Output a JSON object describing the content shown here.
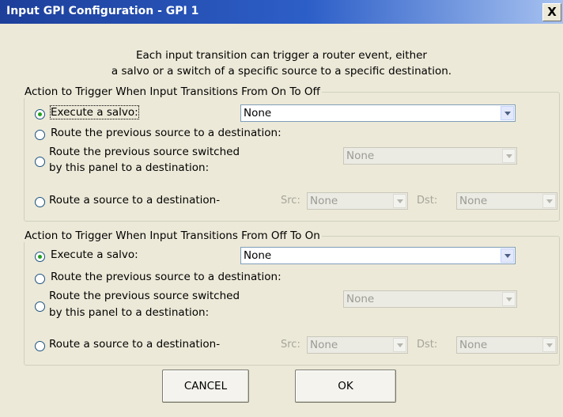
{
  "window": {
    "title": "Input GPI Configuration - GPI 1",
    "close_glyph": "X"
  },
  "description": {
    "line1": "Each input transition can trigger a router event, either",
    "line2": "a salvo or a switch of a specific source to a specific destination."
  },
  "groups": [
    {
      "legend": "Action to Trigger When Input Transitions From On To Off",
      "selected_option": "execute_salvo",
      "execute_salvo_label": "Execute a salvo:",
      "salvo_value": "None",
      "previous_source_label": "Route the previous source to a destination:",
      "panel_switched_line1": "Route the previous source switched",
      "panel_switched_line2": "by this panel to a destination:",
      "panel_switched_value": "None",
      "route_source_label": "Route a source to a destination-",
      "src_label": "Src:",
      "src_value": "None",
      "dst_label": "Dst:",
      "dst_value": "None"
    },
    {
      "legend": "Action to Trigger When Input Transitions From Off To On",
      "selected_option": "execute_salvo",
      "execute_salvo_label": "Execute a salvo:",
      "salvo_value": "None",
      "previous_source_label": "Route the previous source to a destination:",
      "panel_switched_line1": "Route the previous source switched",
      "panel_switched_line2": "by this panel to a destination:",
      "panel_switched_value": "None",
      "route_source_label": "Route a source to a destination-",
      "src_label": "Src:",
      "src_value": "None",
      "dst_label": "Dst:",
      "dst_value": "None"
    }
  ],
  "buttons": {
    "cancel": "CANCEL",
    "ok": "OK"
  }
}
